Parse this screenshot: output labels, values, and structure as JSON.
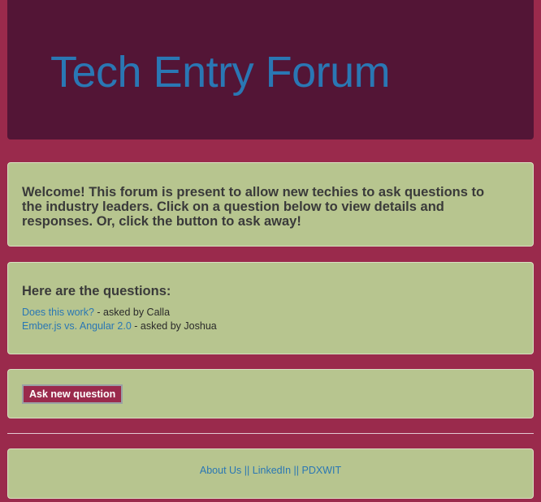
{
  "header": {
    "title": "Tech Entry Forum"
  },
  "welcome": {
    "text": "Welcome! This forum is present to allow new techies to ask questions to the industry leaders. Click on a question below to view details and responses. Or, click the button to ask away!"
  },
  "questions": {
    "heading": "Here are the questions:",
    "items": [
      {
        "title": "Does this work?",
        "meta": " - asked by Calla"
      },
      {
        "title": "Ember.js vs. Angular 2.0",
        "meta": " - asked by Joshua"
      }
    ]
  },
  "ask": {
    "button_label": "Ask new question"
  },
  "footer": {
    "links": [
      {
        "label": "About Us"
      },
      {
        "label": "LinkedIn"
      },
      {
        "label": "PDXWIT"
      }
    ],
    "separator": " || "
  },
  "colors": {
    "background": "#9a2a4c",
    "header_bg": "#531536",
    "panel_bg": "#b7c58f",
    "link": "#2a77b4"
  }
}
